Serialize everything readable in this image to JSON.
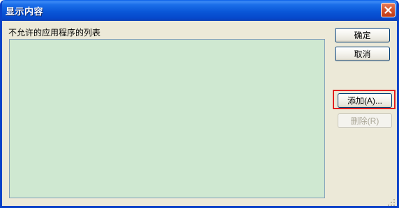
{
  "window": {
    "title": "显示内容"
  },
  "list": {
    "label": "不允许的应用程序的列表",
    "items": []
  },
  "buttons": {
    "ok": "确定",
    "cancel": "取消",
    "add": "添加(A)...",
    "remove": "删除(R)"
  },
  "icons": {
    "close": "close-icon",
    "grip": "resize-grip-icon"
  },
  "colors": {
    "titlebar": "#0a57d8",
    "list_background": "#cfe8d1",
    "highlight_border": "#e02020"
  }
}
